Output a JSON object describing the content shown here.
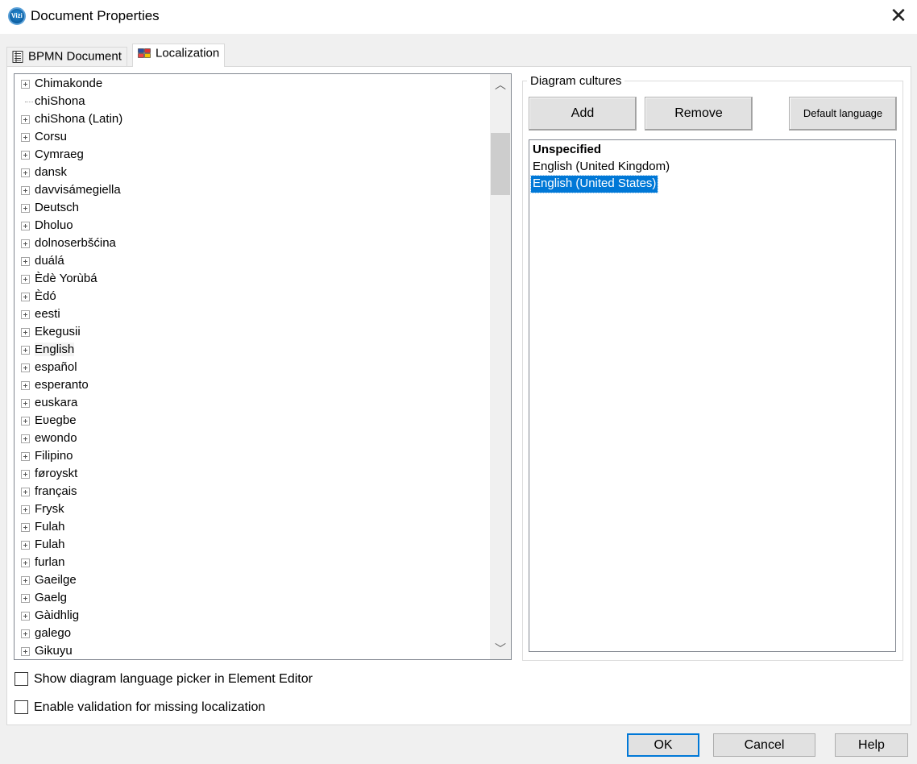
{
  "window": {
    "title": "Document Properties",
    "icon": "vizi-app-icon",
    "icon_text": "Vizi"
  },
  "tabs": [
    {
      "label": "BPMN Document",
      "icon": "document-icon",
      "active": false
    },
    {
      "label": "Localization",
      "icon": "localization-flag-icon",
      "active": true
    }
  ],
  "tree": {
    "items": [
      {
        "label": "Chimakonde",
        "expandable": true
      },
      {
        "label": "chiShona",
        "expandable": false
      },
      {
        "label": "chiShona (Latin)",
        "expandable": true
      },
      {
        "label": "Corsu",
        "expandable": true
      },
      {
        "label": "Cymraeg",
        "expandable": true
      },
      {
        "label": "dansk",
        "expandable": true
      },
      {
        "label": "davvisámegiella",
        "expandable": true
      },
      {
        "label": "Deutsch",
        "expandable": true
      },
      {
        "label": "Dholuo",
        "expandable": true
      },
      {
        "label": "dolnoserbšćina",
        "expandable": true
      },
      {
        "label": "duálá",
        "expandable": true
      },
      {
        "label": "Èdè Yorùbá",
        "expandable": true
      },
      {
        "label": "Èdó",
        "expandable": true
      },
      {
        "label": "eesti",
        "expandable": true
      },
      {
        "label": "Ekegusii",
        "expandable": true
      },
      {
        "label": "English",
        "expandable": true,
        "hover": true
      },
      {
        "label": "español",
        "expandable": true
      },
      {
        "label": "esperanto",
        "expandable": true
      },
      {
        "label": "euskara",
        "expandable": true
      },
      {
        "label": "Eʋegbe",
        "expandable": true
      },
      {
        "label": "ewondo",
        "expandable": true
      },
      {
        "label": "Filipino",
        "expandable": true
      },
      {
        "label": "føroyskt",
        "expandable": true
      },
      {
        "label": "français",
        "expandable": true
      },
      {
        "label": "Frysk",
        "expandable": true
      },
      {
        "label": "Fulah",
        "expandable": true
      },
      {
        "label": "Fulah",
        "expandable": true
      },
      {
        "label": "furlan",
        "expandable": true
      },
      {
        "label": "Gaeilge",
        "expandable": true
      },
      {
        "label": "Gaelg",
        "expandable": true
      },
      {
        "label": "Gàidhlig",
        "expandable": true
      },
      {
        "label": "galego",
        "expandable": true
      },
      {
        "label": "Gikuyu",
        "expandable": true
      }
    ]
  },
  "cultures": {
    "legend": "Diagram cultures",
    "add_label": "Add",
    "remove_label": "Remove",
    "default_label": "Default language",
    "items": [
      {
        "label": "Unspecified",
        "bold": true,
        "selected": false
      },
      {
        "label": "English (United Kingdom)",
        "bold": false,
        "selected": false
      },
      {
        "label": "English (United States)",
        "bold": false,
        "selected": true
      }
    ]
  },
  "options": {
    "show_picker_label": "Show diagram language picker in Element Editor",
    "show_picker_checked": false,
    "enable_validation_label": "Enable validation for missing localization",
    "enable_validation_checked": false
  },
  "footer": {
    "ok_label": "OK",
    "cancel_label": "Cancel",
    "help_label": "Help"
  },
  "colors": {
    "selection": "#0078d7",
    "focus_border": "#0078d7"
  }
}
